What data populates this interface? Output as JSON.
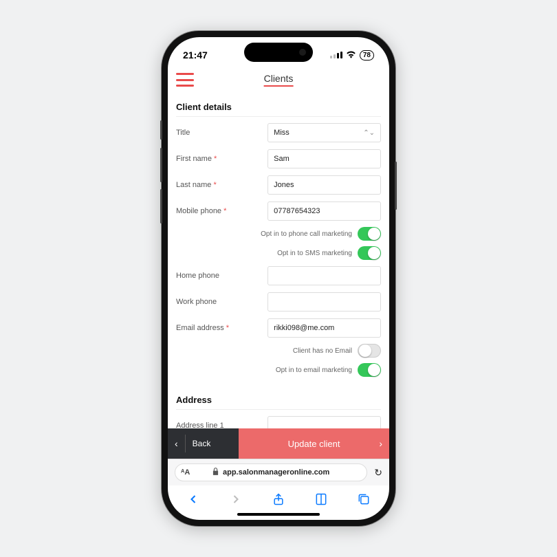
{
  "status": {
    "time": "21:47",
    "battery": "78"
  },
  "header": {
    "title": "Clients"
  },
  "sections": {
    "client_details": "Client details",
    "address": "Address"
  },
  "labels": {
    "title": "Title",
    "first_name": "First name",
    "last_name": "Last name",
    "mobile_phone": "Mobile phone",
    "home_phone": "Home phone",
    "work_phone": "Work phone",
    "email": "Email address",
    "address1": "Address line 1"
  },
  "values": {
    "title": "Miss",
    "first_name": "Sam",
    "last_name": "Jones",
    "mobile_phone": "07787654323",
    "home_phone": "",
    "work_phone": "",
    "email": "rikki098@me.com",
    "address1": ""
  },
  "toggles": {
    "phone_call_marketing": {
      "label": "Opt in to phone call marketing",
      "on": true
    },
    "sms_marketing": {
      "label": "Opt in to SMS marketing",
      "on": true
    },
    "no_email": {
      "label": "Client has no Email",
      "on": false
    },
    "email_marketing": {
      "label": "Opt in to email marketing",
      "on": true
    }
  },
  "actions": {
    "back": "Back",
    "update": "Update client"
  },
  "browser": {
    "url": "app.salonmanageronline.com"
  }
}
